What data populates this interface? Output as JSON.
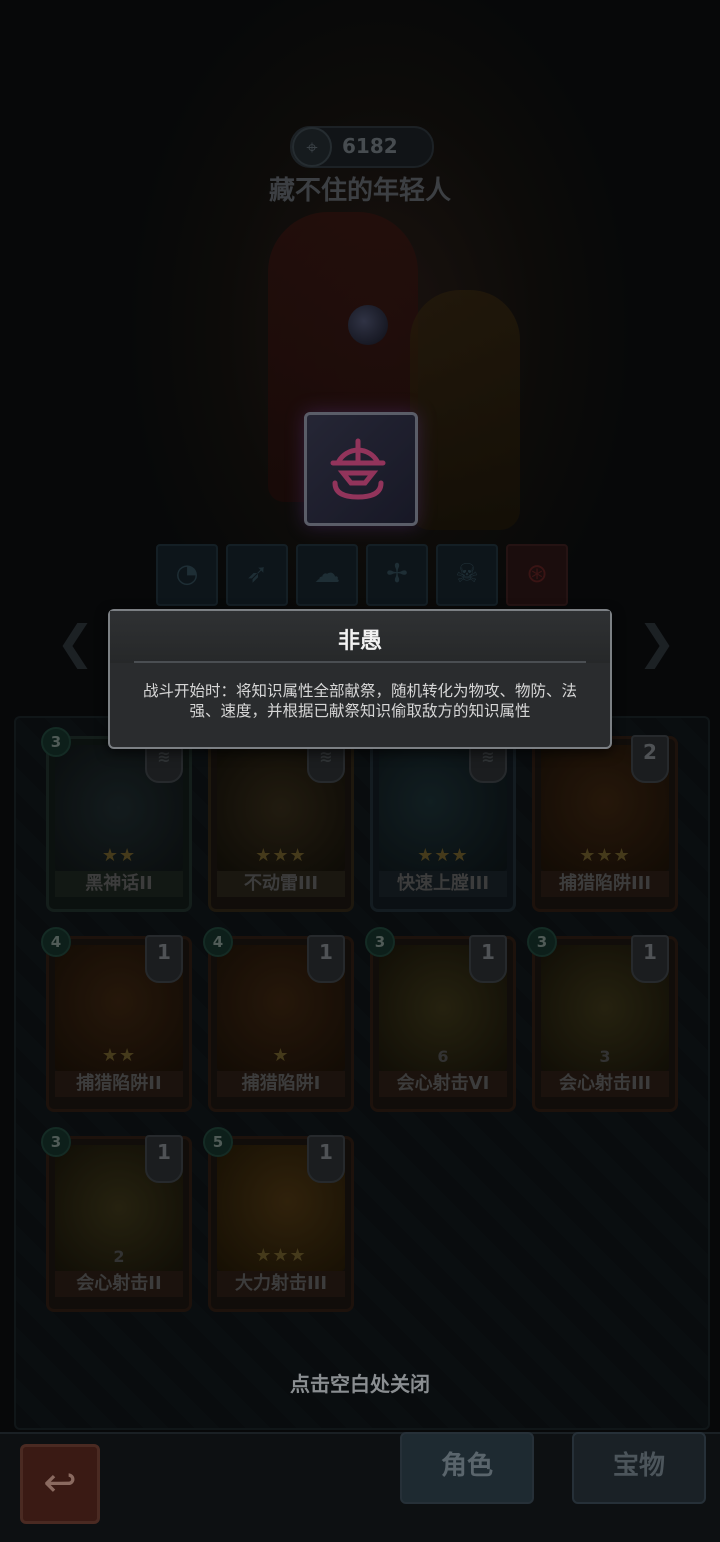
{
  "character": {
    "score": "6182",
    "name": "藏不住的年轻人"
  },
  "rune_slots": [
    {
      "icon": "bear-icon",
      "active": false
    },
    {
      "icon": "bow-icon",
      "active": false
    },
    {
      "icon": "ghost-icon",
      "active": false
    },
    {
      "icon": "crossbow-icon",
      "active": false
    },
    {
      "icon": "skull-icon",
      "active": false
    },
    {
      "icon": "rune-symbol-icon",
      "active": true
    }
  ],
  "tooltip": {
    "title": "非愚",
    "description": "战斗开始时：将知识属性全部献祭，随机转化为物攻、物防、法强、速度，并根据已献祭知识偷取敌方的知识属性"
  },
  "cards": [
    {
      "name": "黑神话II",
      "cost": "3",
      "stack": "",
      "stars": 2,
      "level": ""
    },
    {
      "name": "不动雷III",
      "cost": "",
      "stack": "",
      "stars": 3,
      "level": ""
    },
    {
      "name": "快速上膛III",
      "cost": "",
      "stack": "",
      "stars": 3,
      "level": ""
    },
    {
      "name": "捕猎陷阱III",
      "cost": "",
      "stack": "2",
      "stars": 3,
      "level": ""
    },
    {
      "name": "捕猎陷阱II",
      "cost": "4",
      "stack": "1",
      "stars": 2,
      "level": ""
    },
    {
      "name": "捕猎陷阱I",
      "cost": "4",
      "stack": "1",
      "stars": 1,
      "level": ""
    },
    {
      "name": "会心射击VI",
      "cost": "3",
      "stack": "1",
      "stars": 0,
      "level": "6"
    },
    {
      "name": "会心射击III",
      "cost": "3",
      "stack": "1",
      "stars": 0,
      "level": "3"
    },
    {
      "name": "会心射击II",
      "cost": "3",
      "stack": "1",
      "stars": 0,
      "level": "2"
    },
    {
      "name": "大力射击III",
      "cost": "5",
      "stack": "1",
      "stars": 3,
      "level": ""
    }
  ],
  "close_hint": "点击空白处关闭",
  "nav": {
    "back_icon": "back-arrow-icon",
    "tab_role": "角色",
    "tab_treasure": "宝物"
  }
}
